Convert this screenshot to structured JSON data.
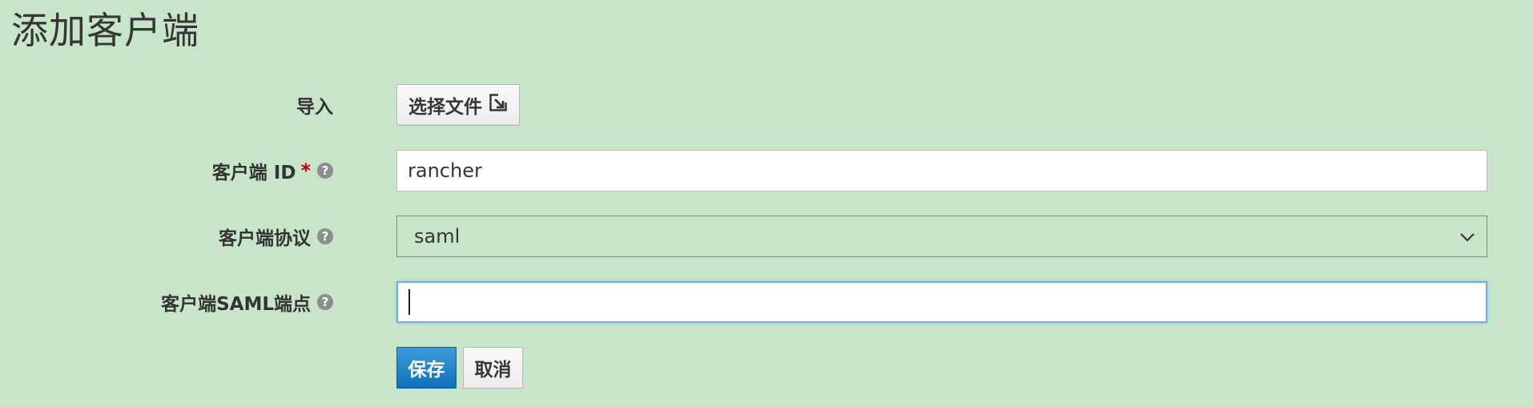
{
  "page": {
    "title": "添加客户端"
  },
  "form": {
    "import": {
      "label": "导入",
      "button_label": "选择文件",
      "button_icon": "import-file-icon"
    },
    "client_id": {
      "label": "客户端 ID",
      "required_mark": "*",
      "help_icon": "?",
      "value": "rancher"
    },
    "protocol": {
      "label": "客户端协议",
      "help_icon": "?",
      "selected": "saml"
    },
    "saml_endpoint": {
      "label": "客户端SAML端点",
      "help_icon": "?",
      "value": ""
    }
  },
  "actions": {
    "save_label": "保存",
    "cancel_label": "取消"
  },
  "colors": {
    "background": "#c8e5c9",
    "primary": "#1a7fc5",
    "required": "#c00000",
    "focus_border": "#66afe9"
  }
}
